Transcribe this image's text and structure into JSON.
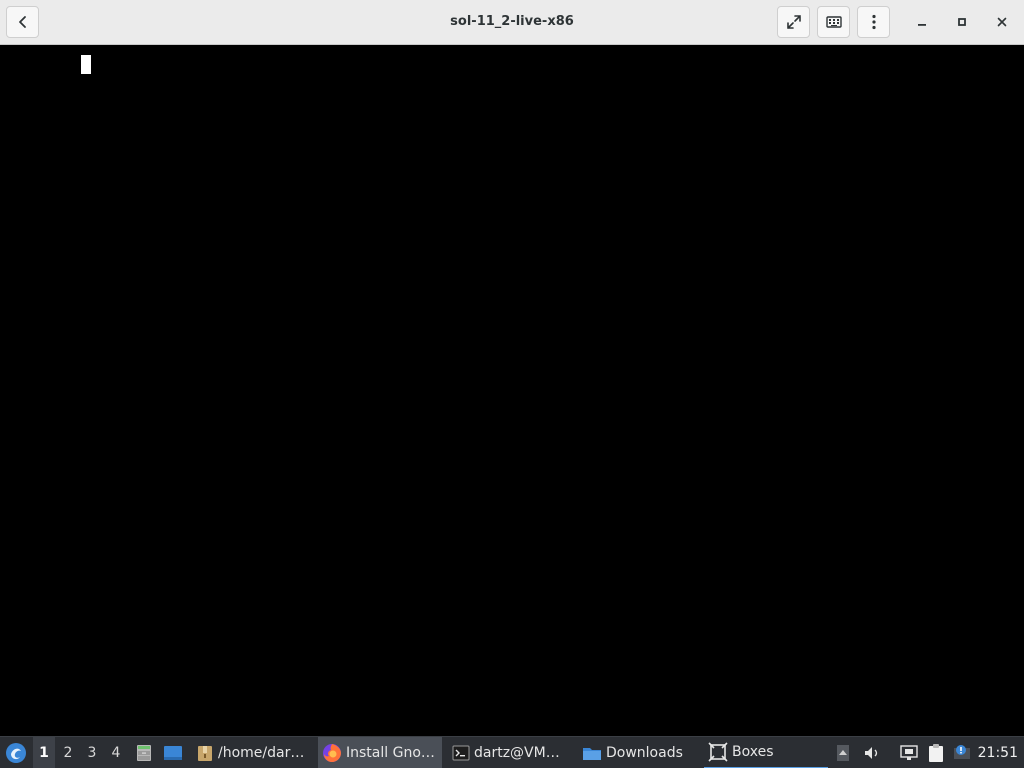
{
  "window": {
    "title": "sol-11_2-live-x86"
  },
  "header": {
    "back_icon": "chevron-left-icon",
    "fullscreen_icon": "fullscreen-icon",
    "keyboard_icon": "keyboard-icon",
    "menu_icon": "vertical-dots-icon",
    "minimize_icon": "minimize-icon",
    "maximize_icon": "maximize-icon",
    "close_icon": "close-icon"
  },
  "taskbar": {
    "start_icon": "start-menu-icon",
    "workspaces": [
      "1",
      "2",
      "3",
      "4"
    ],
    "active_workspace": "1",
    "launchers": [
      "file-cabinet-icon",
      "desktop-icon"
    ],
    "tasks": [
      {
        "label": "/home/dar…",
        "icon": "archive-icon"
      },
      {
        "label": "Install Gno…",
        "icon": "firefox-icon"
      },
      {
        "label": "dartz@VM…",
        "icon": "terminal-icon"
      },
      {
        "label": "Downloads",
        "icon": "folder-icon"
      },
      {
        "label": "Boxes",
        "icon": "boxes-icon"
      }
    ],
    "tray": [
      "tray-up-icon",
      "volume-icon",
      "network-icon",
      "clipboard-icon",
      "update-icon"
    ],
    "clock": "21:51"
  },
  "colors": {
    "header_bg": "#ebebeb",
    "guest_bg": "#000000",
    "taskbar_bg": "#2b2e33",
    "accent": "#5aa0e6"
  }
}
